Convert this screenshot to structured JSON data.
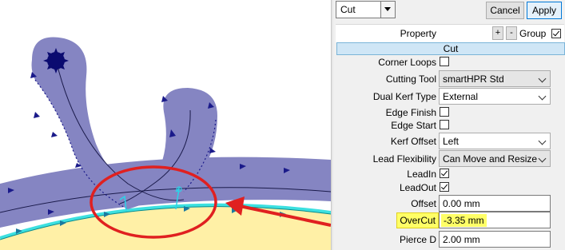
{
  "toolbar": {
    "mode_value": "Cut",
    "cancel_label": "Cancel",
    "apply_label": "Apply"
  },
  "grid_header": {
    "property_label": "Property",
    "plus_label": "+",
    "minus_label": "-",
    "group_label": "Group",
    "group_checked": true
  },
  "section_label": "Cut",
  "properties": {
    "corner_loops": {
      "label": "Corner Loops",
      "checked": false
    },
    "cutting_tool": {
      "label": "Cutting Tool",
      "value": "smartHPR Std"
    },
    "dual_kerf_type": {
      "label": "Dual Kerf Type",
      "value": "External"
    },
    "edge_finish": {
      "label": "Edge Finish",
      "checked": false
    },
    "edge_start": {
      "label": "Edge Start",
      "checked": false
    },
    "kerf_offset": {
      "label": "Kerf Offset",
      "value": "Left"
    },
    "lead_flexibility": {
      "label": "Lead Flexibility",
      "value": "Can Move and Resize"
    },
    "lead_in": {
      "label": "LeadIn",
      "checked": true
    },
    "lead_out": {
      "label": "LeadOut",
      "checked": true
    },
    "offset": {
      "label": "Offset",
      "value": "0.00 mm"
    },
    "overcut": {
      "label": "OverCut",
      "value": "-3.35 mm"
    },
    "pierce_d": {
      "label": "Pierce D",
      "value": "2.00 mm"
    }
  },
  "colors": {
    "part_fill": "#8585c2",
    "sheet_fill": "#fff0a6",
    "highlight": "#ffff66",
    "annotation": "#e02020",
    "section_header": "#cfe6f6"
  }
}
